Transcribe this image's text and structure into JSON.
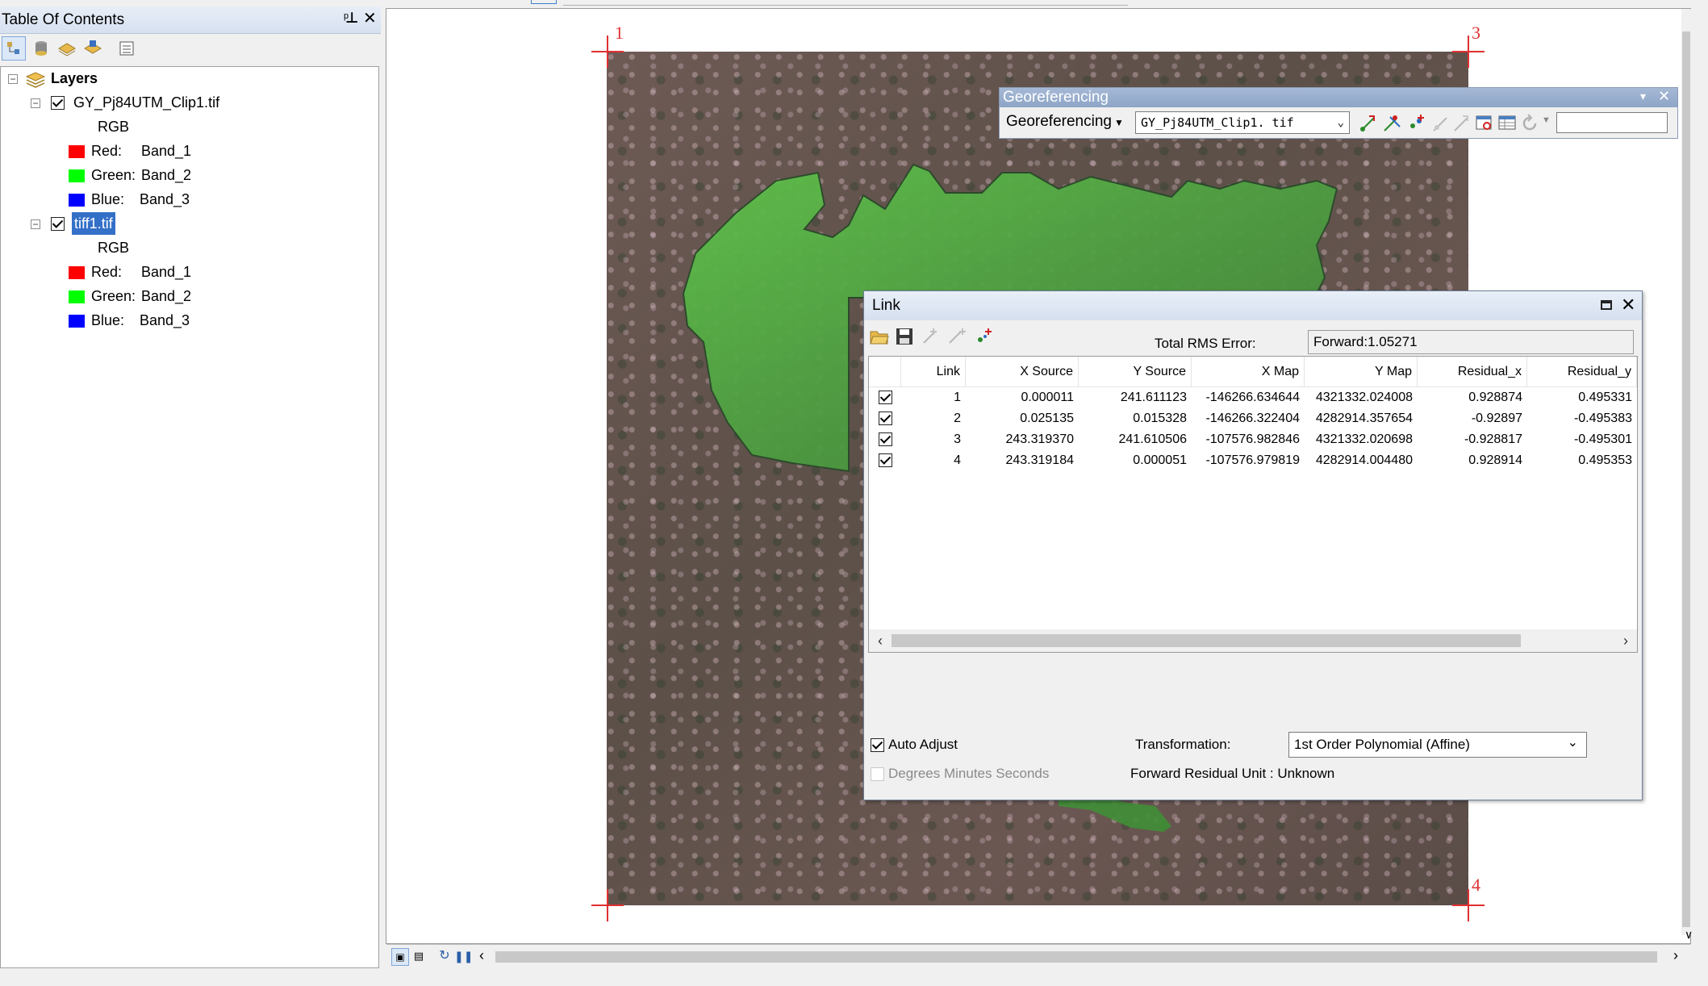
{
  "toc": {
    "title": "Table Of Contents",
    "pin_glyph": "🖈",
    "close_glyph": "✕",
    "toolbar_icons": [
      "list-by-drawing-order-icon",
      "list-by-source-icon",
      "list-by-visibility-icon",
      "list-by-selection-icon",
      "options-icon"
    ],
    "root": "Layers",
    "layers": [
      {
        "name": "GY_Pj84UTM_Clip1.tif",
        "checked": true,
        "selected": false,
        "render": "RGB",
        "bands": [
          {
            "label": "Red:",
            "band": "Band_1",
            "color": "#ff0000"
          },
          {
            "label": "Green:",
            "band": "Band_2",
            "color": "#00ff00"
          },
          {
            "label": "Blue:",
            "band": "Band_3",
            "color": "#0000ff"
          }
        ]
      },
      {
        "name": "tiff1.tif",
        "checked": true,
        "selected": true,
        "render": "RGB",
        "bands": [
          {
            "label": "Red:",
            "band": "Band_1",
            "color": "#ff0000"
          },
          {
            "label": "Green:",
            "band": "Band_2",
            "color": "#00ff00"
          },
          {
            "label": "Blue:",
            "band": "Band_3",
            "color": "#0000ff"
          }
        ]
      }
    ]
  },
  "map": {
    "control_points": [
      "1",
      "3",
      "4"
    ]
  },
  "georef_toolbar": {
    "title": "Georeferencing",
    "menu_label": "Georeferencing",
    "layer_value": "GY_Pj84UTM_Clip1. tif",
    "search_value": ""
  },
  "link": {
    "title": "Link",
    "rms_label": "Total RMS Error:",
    "rms_value": "Forward:1.05271",
    "columns": [
      "Link",
      "X Source",
      "Y Source",
      "X Map",
      "Y Map",
      "Residual_x",
      "Residual_y"
    ],
    "rows": [
      {
        "checked": true,
        "cells": [
          "1",
          "0.000011",
          "241.611123",
          "-146266.634644",
          "4321332.024008",
          "0.928874",
          "0.495331"
        ]
      },
      {
        "checked": true,
        "cells": [
          "2",
          "0.025135",
          "0.015328",
          "-146266.322404",
          "4282914.357654",
          "-0.92897",
          "-0.495383"
        ]
      },
      {
        "checked": true,
        "cells": [
          "3",
          "243.319370",
          "241.610506",
          "-107576.982846",
          "4321332.020698",
          "-0.928817",
          "-0.495301"
        ]
      },
      {
        "checked": true,
        "cells": [
          "4",
          "243.319184",
          "0.000051",
          "-107576.979819",
          "4282914.004480",
          "0.928914",
          "0.495353"
        ]
      }
    ],
    "auto_adjust": "Auto Adjust",
    "auto_adjust_checked": true,
    "dms_label": "Degrees Minutes Seconds",
    "dms_checked": false,
    "transformation_label": "Transformation:",
    "transformation_value": "1st Order Polynomial (Affine)",
    "residual_unit": "Forward Residual Unit : Unknown"
  }
}
